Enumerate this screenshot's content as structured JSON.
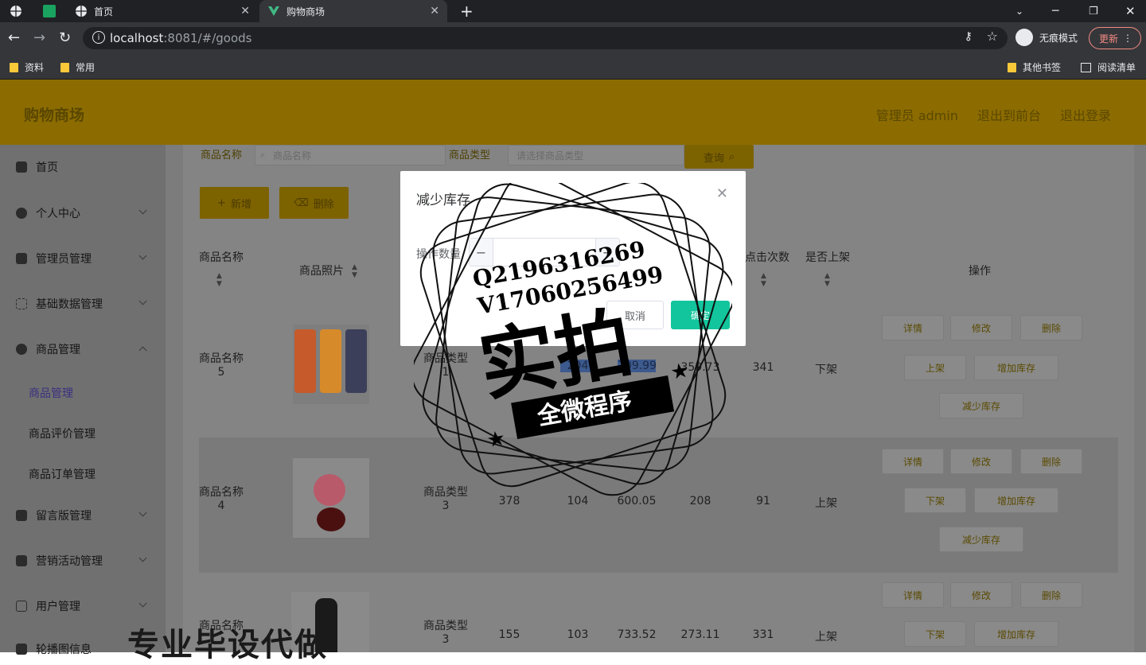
{
  "browser": {
    "tabs": [
      {
        "label": "首页",
        "active": false
      },
      {
        "label": "购物商场",
        "active": true
      }
    ],
    "address": {
      "host": "localhost",
      "rest": ":8081/#/goods"
    },
    "profile_label": "无痕模式",
    "update_label": "更新",
    "bookmarks": [
      "资料",
      "常用"
    ],
    "bookmarks_right": [
      "其他书签",
      "阅读清单"
    ]
  },
  "header": {
    "title": "购物商场",
    "links": [
      "管理员 admin",
      "退出到前台",
      "退出登录"
    ]
  },
  "sidebar": {
    "items": [
      {
        "label": "首页",
        "icon": "home-icon"
      },
      {
        "label": "个人中心",
        "icon": "user-icon"
      },
      {
        "label": "管理员管理",
        "icon": "admin-icon"
      },
      {
        "label": "基础数据管理",
        "icon": "grid-icon"
      },
      {
        "label": "商品管理",
        "icon": "user-icon"
      },
      {
        "label": "留言版管理",
        "icon": "message-icon"
      },
      {
        "label": "营销活动管理",
        "icon": "campaign-icon"
      },
      {
        "label": "用户管理",
        "icon": "users-icon"
      },
      {
        "label": "轮播图信息",
        "icon": "image-icon"
      }
    ],
    "subitems": [
      "商品管理",
      "商品评价管理",
      "商品订单管理"
    ]
  },
  "search": {
    "name_label": "商品名称",
    "name_placeholder": "商品名称",
    "type_label": "商品类型",
    "type_placeholder": "请选择商品类型",
    "query_label": "查询"
  },
  "toolbar": {
    "add_label": "新增",
    "delete_label": "删除"
  },
  "table": {
    "headers": [
      "商品名称",
      "商品照片",
      "点击次数",
      "是否上架",
      "操作"
    ],
    "rows": [
      {
        "name": "商品名称\n5",
        "type": "商品类型\n1",
        "stock": "204",
        "price": "709.99",
        "new_price": "359.73",
        "clicks": "341",
        "status": "下架"
      },
      {
        "name": "商品名称\n4",
        "type": "商品类型\n3",
        "col3": "378",
        "stock": "104",
        "price": "600.05",
        "new_price": "208",
        "clicks": "91",
        "status": "上架"
      },
      {
        "name": "商品名称",
        "type": "商品类型\n3",
        "col3": "155",
        "stock": "103",
        "price": "733.52",
        "new_price": "273.11",
        "clicks": "331",
        "status": "上架"
      }
    ],
    "actions": [
      "详情",
      "修改",
      "删除",
      "上架",
      "下架",
      "增加库存",
      "减少库存"
    ]
  },
  "dialog": {
    "title": "减少库存",
    "qty_label": "操作数量",
    "qty_value": "",
    "cancel_label": "取消",
    "ok_label": "确定"
  },
  "watermark": {
    "line1": "Q2196316269",
    "line2": "V17060256499",
    "big": "实拍",
    "banner": "全微程序"
  },
  "caption": "专业毕设代做"
}
